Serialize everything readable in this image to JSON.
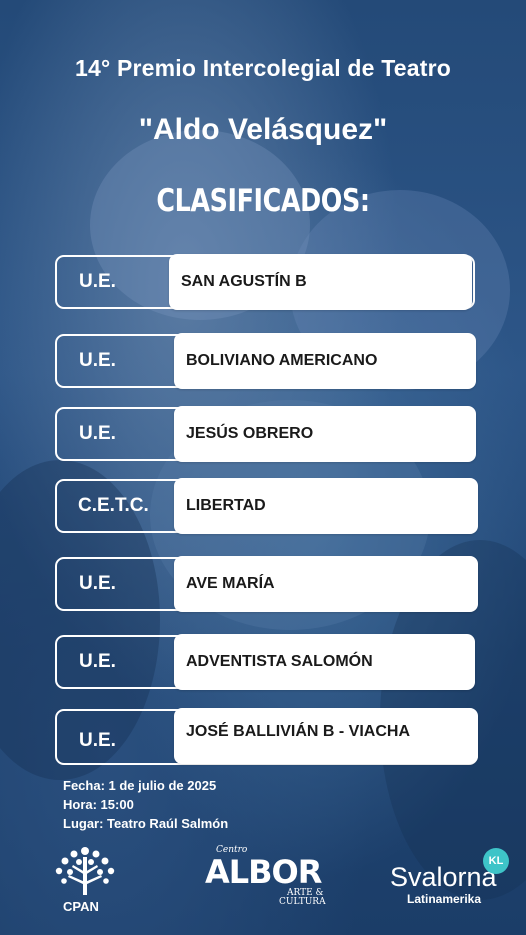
{
  "header": {
    "line1": "14° Premio Intercolegial de Teatro",
    "line2": "\"Aldo Velásquez\"",
    "line3": "CLASIFICADOS:"
  },
  "rows": [
    {
      "prefix": "U.E.",
      "name": "SAN AGUSTÍN B"
    },
    {
      "prefix": "U.E.",
      "name": "BOLIVIANO AMERICANO"
    },
    {
      "prefix": "U.E.",
      "name": "JESÚS OBRERO"
    },
    {
      "prefix": "C.E.T.C.",
      "name": "LIBERTAD"
    },
    {
      "prefix": "U.E.",
      "name": "AVE MARÍA"
    },
    {
      "prefix": "U.E.",
      "name": "ADVENTISTA SALOMÓN"
    },
    {
      "prefix": "U.E.",
      "name": "JOSÉ BALLIVIÁN B - VIACHA"
    }
  ],
  "info": {
    "fecha": "Fecha: 1 de julio de 2025",
    "hora": "Hora: 15:00",
    "lugar": "Lugar: Teatro Raúl Salmón"
  },
  "logos": {
    "cpan": "CPAN",
    "albor_small": "Centro",
    "albor_main": "ALBOR",
    "albor_sub1": "ARTE &",
    "albor_sub2": "CULTURA",
    "svalorna_main": "Svalorna",
    "svalorna_sub": "Latinamerika",
    "svalorna_badge": "KL"
  }
}
